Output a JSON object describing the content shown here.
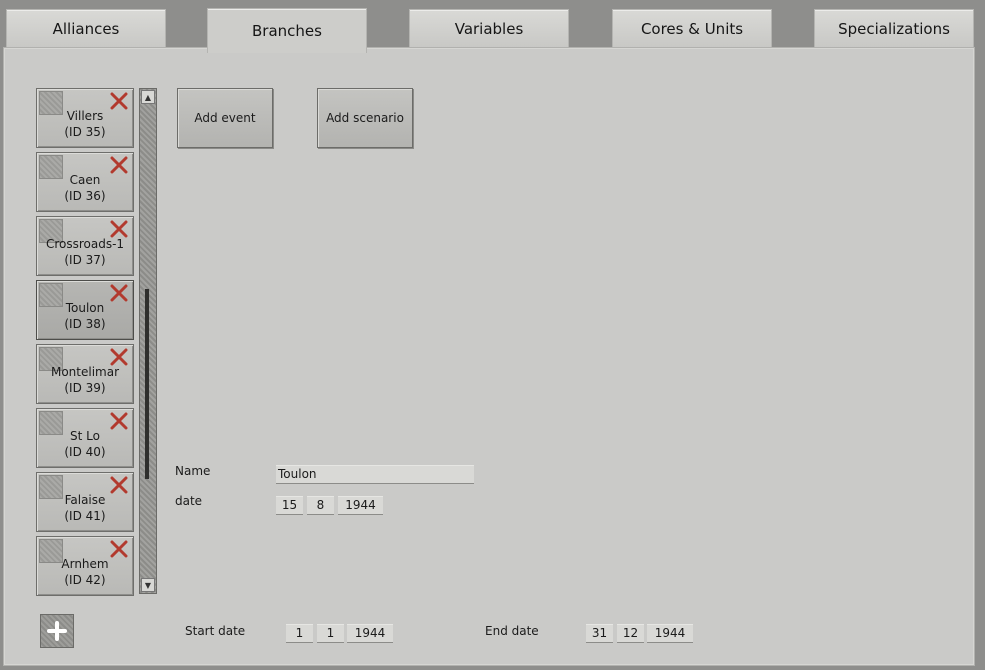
{
  "tabs": [
    {
      "label": "Alliances"
    },
    {
      "label": "Branches",
      "active": true
    },
    {
      "label": "Variables"
    },
    {
      "label": "Cores & Units"
    },
    {
      "label": "Specializations"
    }
  ],
  "branches": [
    {
      "name": "Villers",
      "id": "(ID 35)"
    },
    {
      "name": "Caen",
      "id": "(ID 36)"
    },
    {
      "name": "Crossroads-1",
      "id": "(ID 37)"
    },
    {
      "name": "Toulon",
      "id": "(ID 38)",
      "selected": true
    },
    {
      "name": "Montelimar",
      "id": "(ID 39)"
    },
    {
      "name": "St Lo",
      "id": "(ID 40)"
    },
    {
      "name": "Falaise",
      "id": "(ID 41)"
    },
    {
      "name": "Arnhem",
      "id": "(ID 42)"
    }
  ],
  "buttons": {
    "add_event": "Add event",
    "add_scenario": "Add scenario"
  },
  "form": {
    "name_label": "Name",
    "name_value": "Toulon",
    "date_label": "date",
    "date": {
      "day": "15",
      "month": "8",
      "year": "1944"
    }
  },
  "footer": {
    "start_label": "Start date",
    "start": {
      "day": "1",
      "month": "1",
      "year": "1944"
    },
    "end_label": "End date",
    "end": {
      "day": "31",
      "month": "12",
      "year": "1944"
    }
  },
  "icons": {
    "delete": "x-icon",
    "add": "plus-icon",
    "scroll_up": "arrow-up-icon",
    "scroll_down": "arrow-down-icon"
  },
  "colors": {
    "delete_x": "#b23a2e",
    "panel": "#cacac8"
  }
}
